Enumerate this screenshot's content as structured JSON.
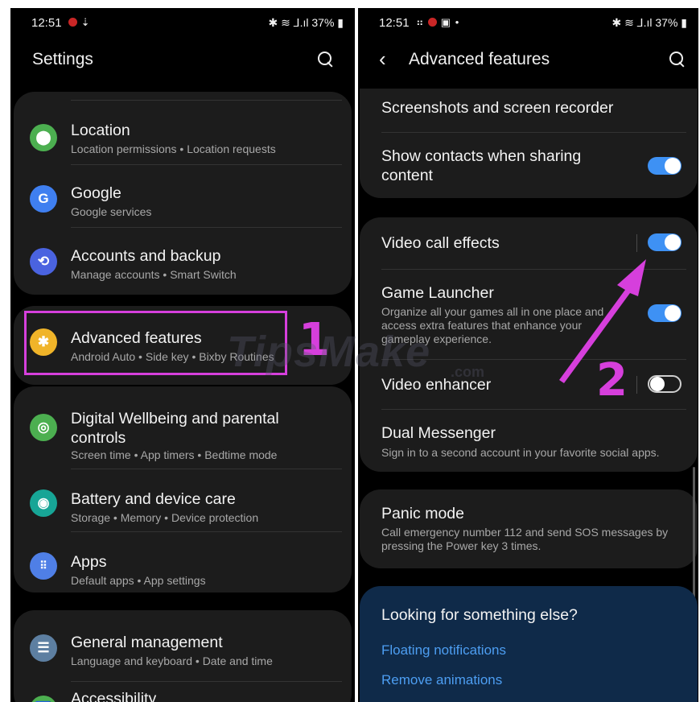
{
  "left": {
    "status": {
      "time": "12:51",
      "battery": "37%",
      "icons_right": "✱ ☰ ▲.ıl"
    },
    "header": {
      "title": "Settings"
    },
    "items": [
      {
        "title": "Location",
        "sub": "Location permissions  •  Location requests",
        "icon": "location-pin-icon",
        "color": "#4caf50"
      },
      {
        "title": "Google",
        "sub": "Google services",
        "icon": "google-g-icon",
        "color": "#3f7ff0"
      },
      {
        "title": "Accounts and backup",
        "sub": "Manage accounts  •  Smart Switch",
        "icon": "sync-icon",
        "color": "#4a63e0"
      },
      {
        "title": "Advanced features",
        "sub": "Android Auto  •  Side key  •  Bixby Routines",
        "icon": "gear-plus-icon",
        "color": "#f0b429"
      },
      {
        "title": "Digital Wellbeing and parental controls",
        "sub": "Screen time  •  App timers  •  Bedtime mode",
        "icon": "wellbeing-icon",
        "color": "#4caf50"
      },
      {
        "title": "Battery and device care",
        "sub": "Storage  •  Memory  •  Device protection",
        "icon": "device-care-icon",
        "color": "#17a596"
      },
      {
        "title": "Apps",
        "sub": "Default apps  •  App settings",
        "icon": "apps-grid-icon",
        "color": "#4f7fe6"
      },
      {
        "title": "General management",
        "sub": "Language and keyboard  •  Date and time",
        "icon": "sliders-icon",
        "color": "#5d7fa1"
      },
      {
        "title": "Accessibility",
        "sub": "",
        "icon": "accessibility-icon",
        "color": "#4caf50"
      }
    ],
    "annotation": "1"
  },
  "right": {
    "status": {
      "time": "12:51",
      "battery": "37%",
      "icons_right": "✱ ☰ ▲.ıl"
    },
    "header": {
      "title": "Advanced features"
    },
    "items": [
      {
        "title": "Screenshots and screen recorder"
      },
      {
        "title": "Show contacts when sharing content",
        "toggle": true
      },
      {
        "title": "Video call effects",
        "toggle": true
      },
      {
        "title": "Game Launcher",
        "sub": "Organize all your games all in one place and access extra features that enhance your gameplay experience.",
        "toggle": true
      },
      {
        "title": "Video enhancer",
        "toggle": false
      },
      {
        "title": "Dual Messenger",
        "sub": "Sign in to a second account in your favorite social apps."
      },
      {
        "title": "Panic mode",
        "sub": "Call emergency number 112 and send SOS messages by pressing the Power key 3 times."
      }
    ],
    "help": {
      "title": "Looking for something else?",
      "links": [
        "Floating notifications",
        "Remove animations"
      ]
    },
    "annotation": "2"
  },
  "watermark": {
    "text": "TipsMake",
    "suffix": ".com"
  },
  "colors": {
    "annotation": "#d63fdc",
    "toggle_on": "#3e91f4",
    "link": "#4d9ef2"
  }
}
